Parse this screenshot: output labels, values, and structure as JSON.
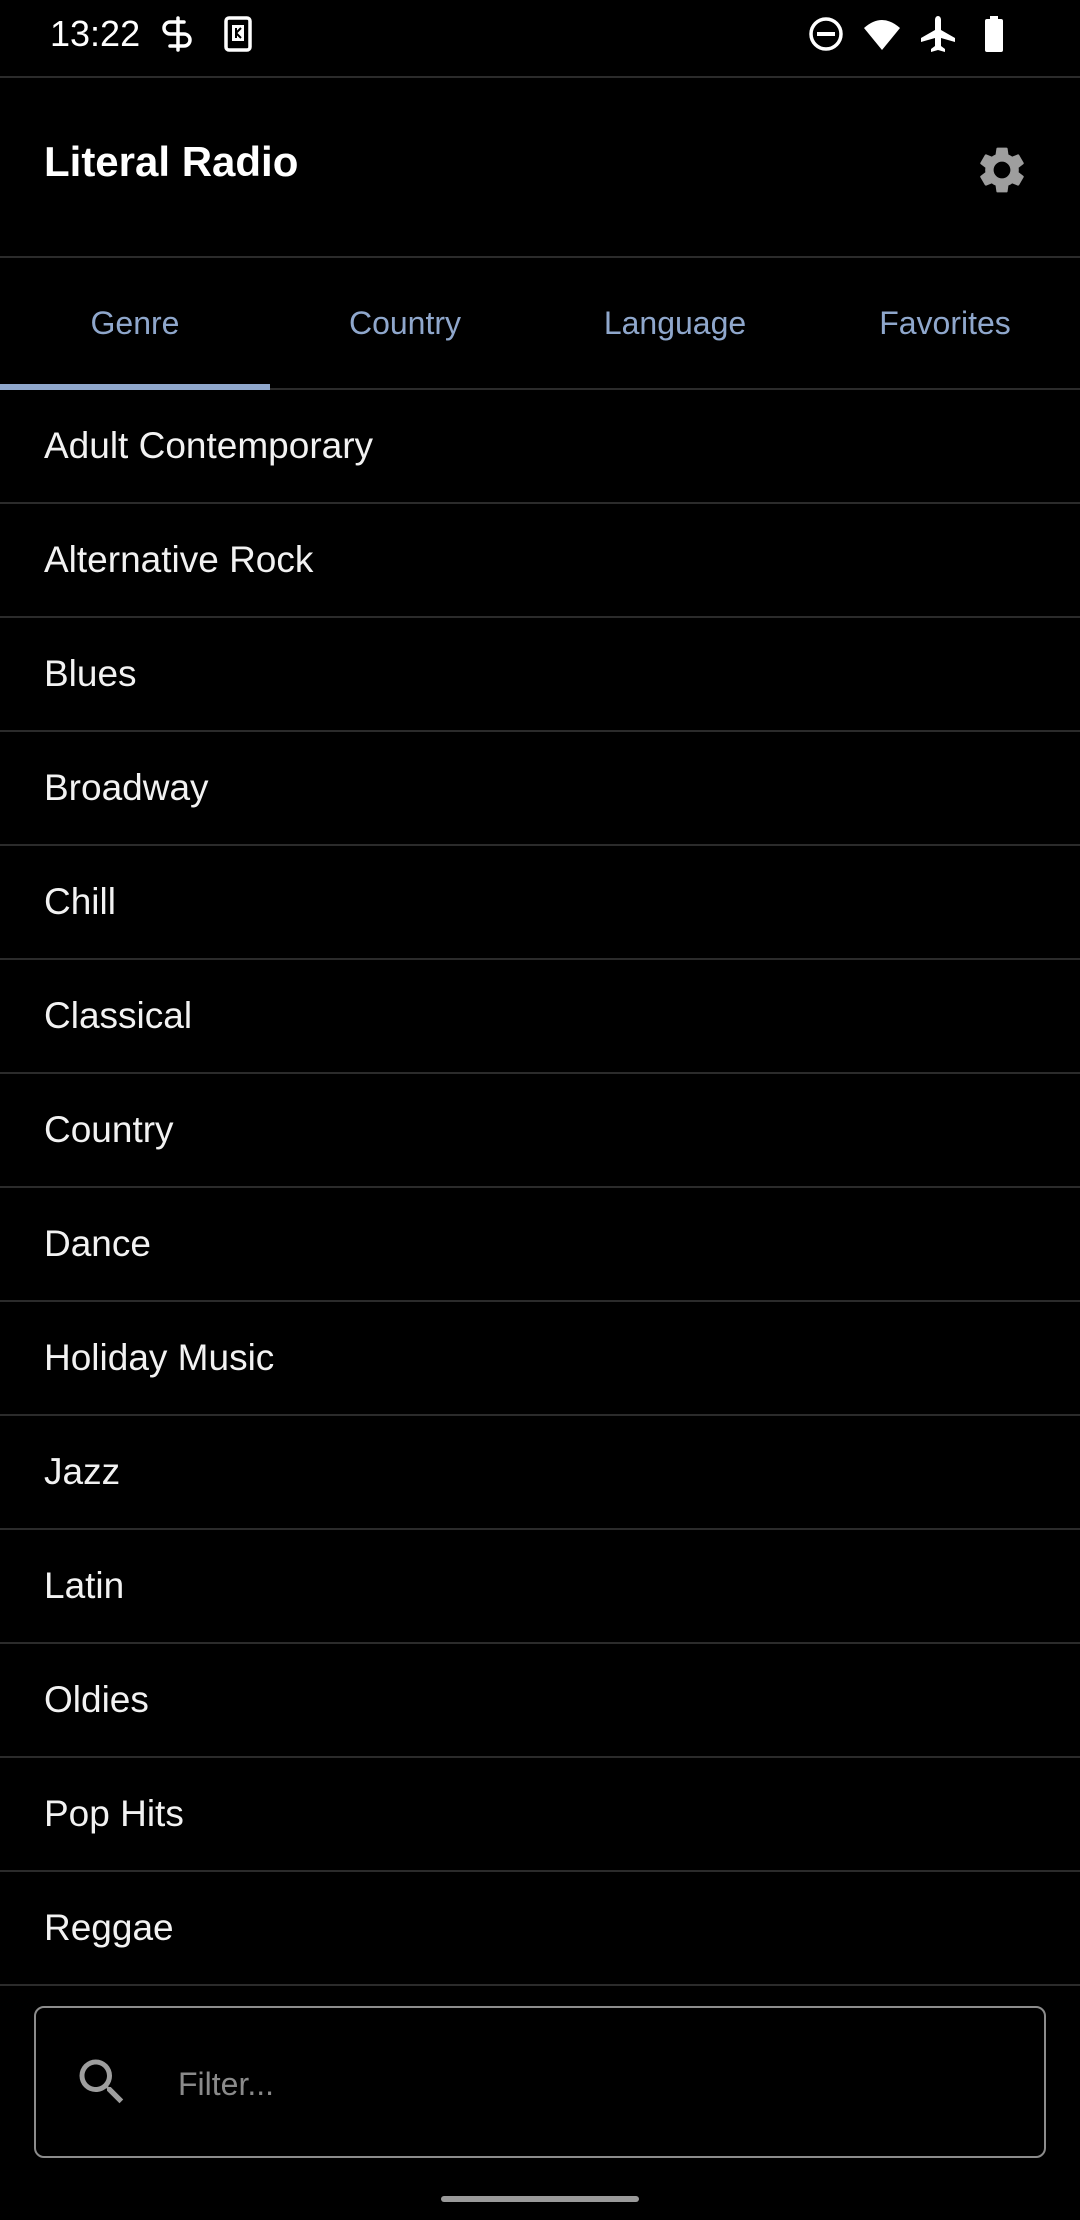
{
  "status_bar": {
    "time": "13:22",
    "icons_left": [
      "authenticator-icon",
      "app-notification-icon"
    ],
    "icons_right": [
      "do-not-disturb-icon",
      "wifi-icon",
      "airplane-icon",
      "battery-icon"
    ]
  },
  "app_bar": {
    "title": "Literal Radio",
    "settings_icon": "gear-icon"
  },
  "tabs": [
    {
      "label": "Genre",
      "selected": true
    },
    {
      "label": "Country",
      "selected": false
    },
    {
      "label": "Language",
      "selected": false
    },
    {
      "label": "Favorites",
      "selected": false
    }
  ],
  "genres": [
    "Adult Contemporary",
    "Alternative Rock",
    "Blues",
    "Broadway",
    "Chill",
    "Classical",
    "Country",
    "Dance",
    "Holiday Music",
    "Jazz",
    "Latin",
    "Oldies",
    "Pop Hits",
    "Reggae"
  ],
  "filter": {
    "placeholder": "Filter...",
    "value": "",
    "icon": "search-icon"
  },
  "colors": {
    "background": "#000000",
    "accent": "#8fa7cc",
    "divider": "#2b2b2b",
    "text": "#ffffff"
  }
}
